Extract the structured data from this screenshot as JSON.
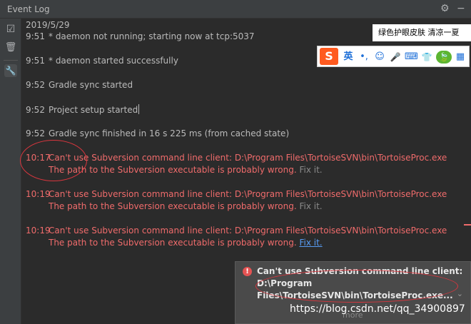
{
  "window": {
    "title": "Event Log"
  },
  "icons": {
    "gear": "⚙",
    "minimize": "−",
    "check": "☑",
    "trash": "🗑",
    "wrench": "🔧"
  },
  "log": {
    "date": "2019/5/29",
    "entries": [
      {
        "time": "9:51",
        "message": "* daemon not running; starting now at tcp:5037"
      },
      {
        "time": "9:51",
        "message": "* daemon started successfully"
      },
      {
        "time": "9:52",
        "message": "Gradle sync started"
      },
      {
        "time": "9:52",
        "message": "Project setup started"
      },
      {
        "time": "9:52",
        "message": "Gradle sync finished in 16 s 225 ms (from cached state)"
      },
      {
        "time": "10:17",
        "message": "Can't use Subversion command line client: D:\\Program Files\\TortoiseSVN\\bin\\TortoiseProc.exe",
        "detail": "The path to the Subversion executable is probably wrong.",
        "fix": "Fix it."
      },
      {
        "time": "10:19",
        "message": "Can't use Subversion command line client: D:\\Program Files\\TortoiseSVN\\bin\\TortoiseProc.exe",
        "detail": "The path to the Subversion executable is probably wrong.",
        "fix": "Fix it."
      },
      {
        "time": "10:19",
        "message": "Can't use Subversion command line client: D:\\Program Files\\TortoiseSVN\\bin\\TortoiseProc.exe",
        "detail": "The path to the Subversion executable is probably wrong.",
        "fix": "Fix it."
      }
    ]
  },
  "ime": {
    "tooltip": "绿色护眼皮肤 清凉一夏",
    "logo": "S",
    "lang": "英",
    "punct": "•,",
    "emoji": "☺",
    "mic": "🎤",
    "keyboard": "⌨",
    "skin": "👕",
    "user": "👤",
    "leaf": "🍃",
    "grid": "▦"
  },
  "balloon": {
    "line1": "Can't use Subversion command line client:",
    "line2": "D:\\Program",
    "line3": "Files\\TortoiseSVN\\bin\\TortoiseProc.exe...",
    "more": "more",
    "chevron": "⌄",
    "err_icon": "!"
  },
  "watermark": "https://blog.csdn.net/qq_34900897",
  "colors": {
    "error": "#ef6b6b",
    "link": "#589df6",
    "background": "#2b2b2b"
  }
}
